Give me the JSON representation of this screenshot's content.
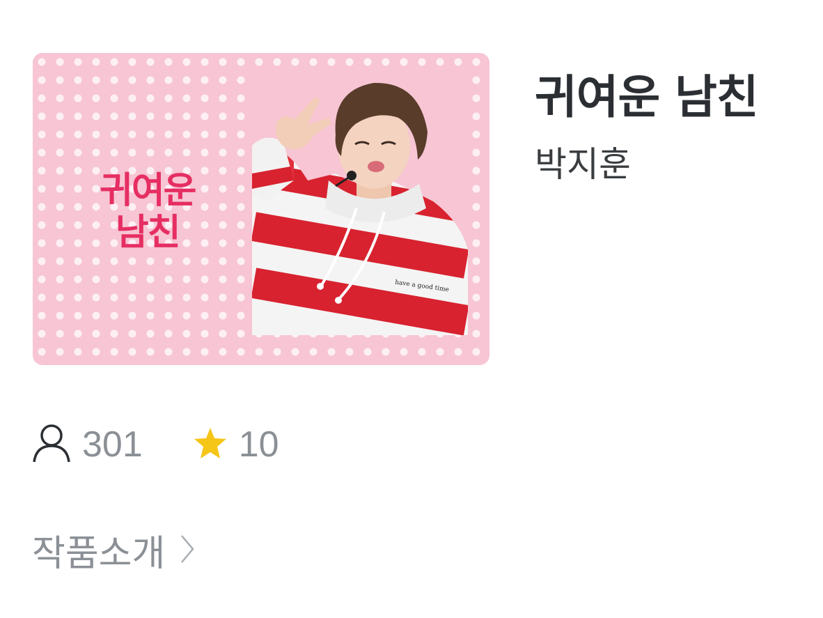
{
  "cover": {
    "line1": "귀여운",
    "line2": "남친",
    "background_color": "#f7c5d3",
    "text_color": "#e62e63"
  },
  "product": {
    "title": "귀여운 남친",
    "author": "박지훈"
  },
  "stats": {
    "users_icon": "person-icon",
    "users_count": "301",
    "rating_icon": "star-icon",
    "rating": "10",
    "star_color": "#f5c518"
  },
  "intro": {
    "label": "작품소개",
    "icon": "chevron-right-icon"
  },
  "photo": {
    "shirt_text": "have a good time"
  }
}
